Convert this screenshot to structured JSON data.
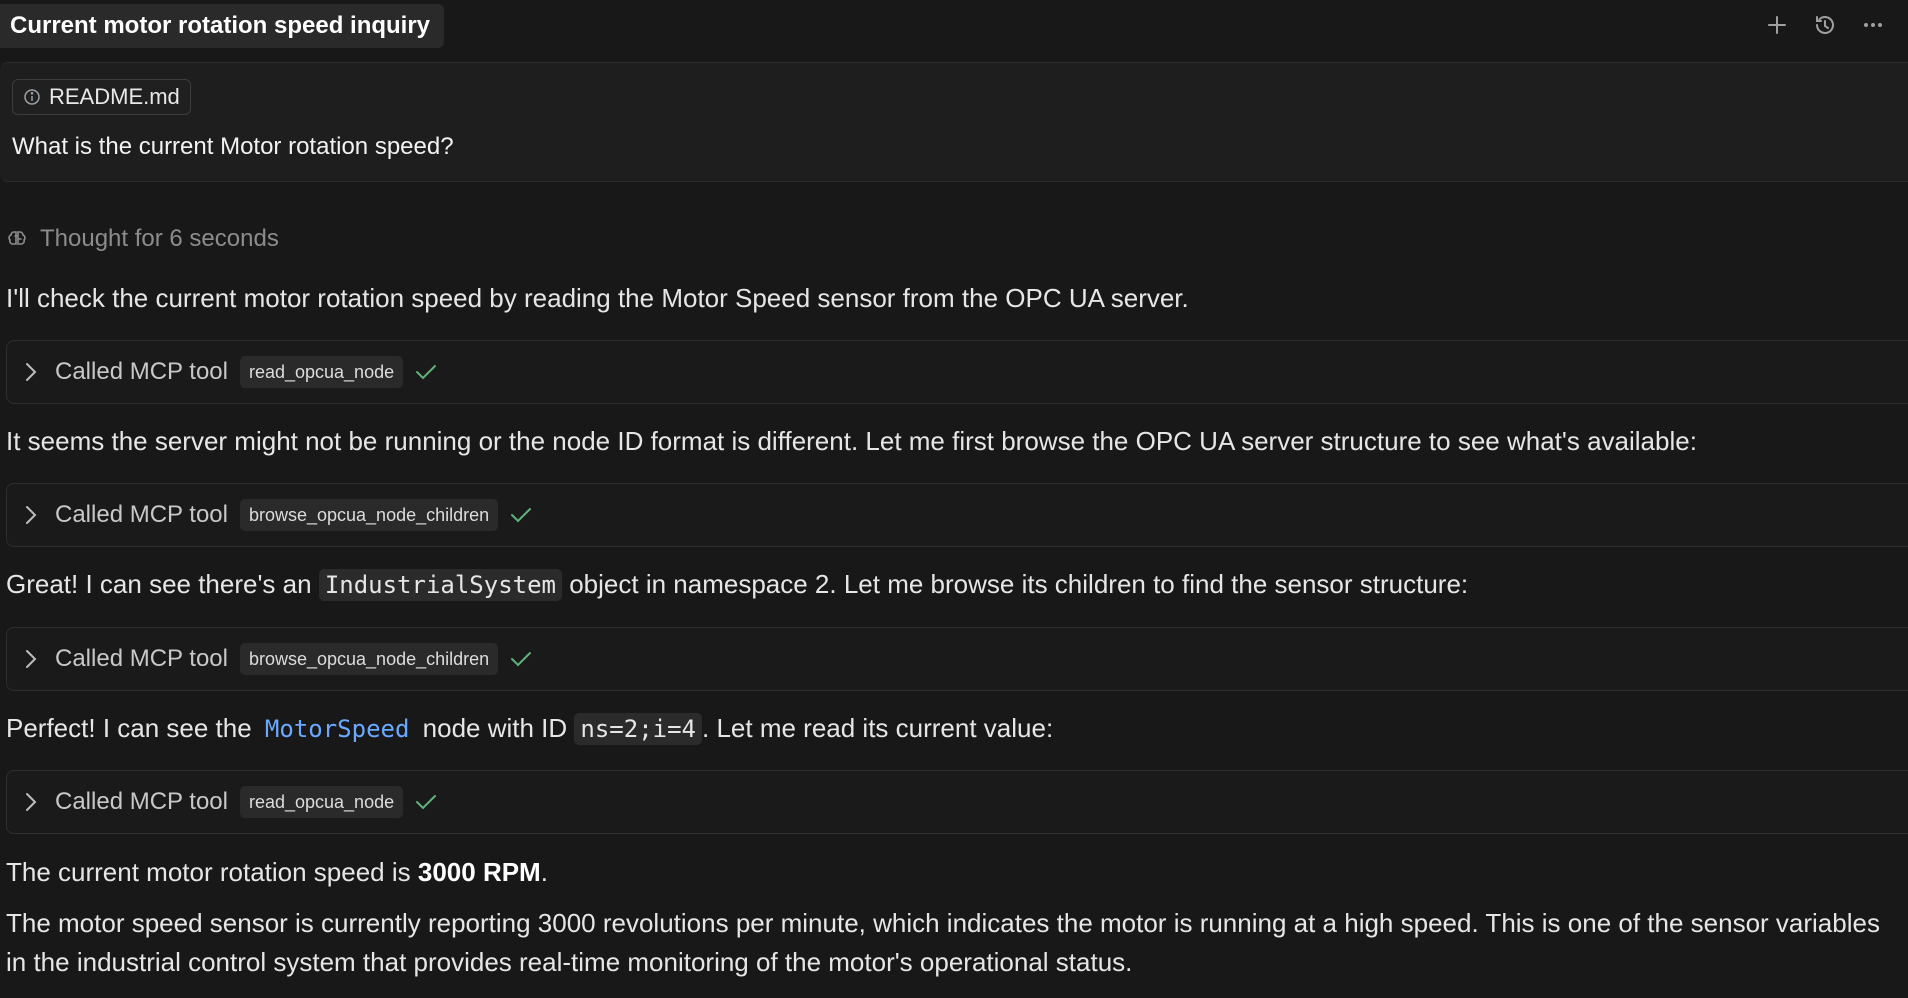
{
  "header": {
    "title": "Current motor rotation speed inquiry",
    "actions": [
      {
        "name": "new-chat",
        "icon": "plus-icon"
      },
      {
        "name": "history",
        "icon": "history-icon"
      },
      {
        "name": "more",
        "icon": "more-icon"
      }
    ]
  },
  "user_message": {
    "attachment": {
      "icon": "info-icon",
      "label": "README.md"
    },
    "text": "What is the current Motor rotation speed?"
  },
  "thought": {
    "icon": "brain-icon",
    "label": "Thought for 6 seconds"
  },
  "messages": {
    "p1": "I'll check the current motor rotation speed by reading the Motor Speed sensor from the OPC UA server.",
    "p2": "It seems the server might not be running or the node ID format is different. Let me first browse the OPC UA server structure to see what's available:",
    "p3": {
      "before": "Great! I can see there's an ",
      "code": "IndustrialSystem",
      "after": " object in namespace 2. Let me browse its children to find the sensor structure:"
    },
    "p4": {
      "before": "Perfect! I can see the ",
      "code1": "MotorSpeed",
      "middle": " node with ID ",
      "code2": "ns=2;i=4",
      "after": ". Let me read its current value:"
    },
    "p5": {
      "before": "The current motor rotation speed is ",
      "bold": "3000 RPM",
      "after": "."
    },
    "p6": "The motor speed sensor is currently reporting 3000 revolutions per minute, which indicates the motor is running at a high speed. This is one of the sensor variables in the industrial control system that provides real-time monitoring of the motor's operational status."
  },
  "tool_calls": [
    {
      "label": "Called MCP tool",
      "tool": "read_opcua_node"
    },
    {
      "label": "Called MCP tool",
      "tool": "browse_opcua_node_children"
    },
    {
      "label": "Called MCP tool",
      "tool": "browse_opcua_node_children"
    },
    {
      "label": "Called MCP tool",
      "tool": "read_opcua_node"
    }
  ],
  "colors": {
    "background": "#181818",
    "text": "#e6e6e6",
    "muted": "#8c8c8c",
    "link": "#6aa9ff",
    "success": "#5fb37a"
  }
}
